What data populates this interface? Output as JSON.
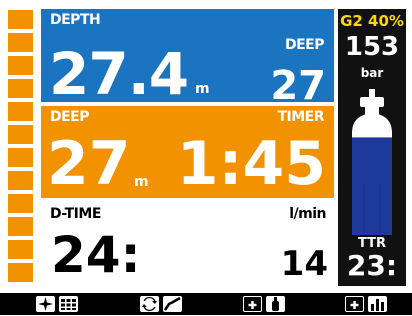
{
  "depth_panel": {
    "label": "DEPTH",
    "value": "27.4",
    "unit": "m",
    "deep_label": "DEEP",
    "deep_value": "27"
  },
  "deep_panel": {
    "label": "DEEP",
    "value": "27",
    "unit": "m",
    "timer_label": "TIMER",
    "timer_value": "1:45"
  },
  "dtime_panel": {
    "label": "D-TIME",
    "value": "24:",
    "rate_unit": "l/min",
    "rate_value": "14"
  },
  "gas": {
    "label": "G2 40%",
    "pressure": "153",
    "pressure_unit": "bar",
    "tank_fill_fraction": 0.8,
    "ttr_label": "TTR",
    "ttr_value": "23:"
  },
  "level_indicator": {
    "segments": 14
  },
  "softkeys": [
    {
      "name": "compass-grid",
      "icons": [
        "compass-icon",
        "grid-icon"
      ]
    },
    {
      "name": "switch-graph",
      "icons": [
        "swap-icon",
        "graph-icon"
      ]
    },
    {
      "name": "dive-plan",
      "icons": [
        "plus-icon",
        "tank-icon"
      ]
    },
    {
      "name": "add-chart",
      "icons": [
        "plus-icon",
        "bar-chart-icon"
      ]
    }
  ],
  "colors": {
    "blue": "#1a74c0",
    "orange": "#f39200",
    "dark": "#111111",
    "tank": "#1d3a9a",
    "gas_text": "#ffd800"
  }
}
